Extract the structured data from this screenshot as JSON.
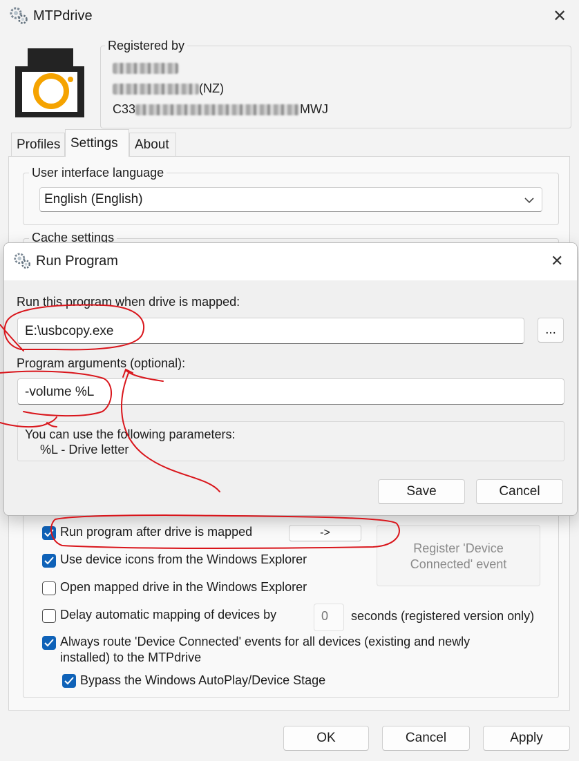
{
  "window": {
    "title": "MTPdrive",
    "icon": "gear-icon"
  },
  "registration": {
    "label": "Registered by",
    "line1_visible": "",
    "line2_visible": "(NZ)",
    "line3_prefix": "C33",
    "line3_suffix": "MWJ"
  },
  "tabs": [
    {
      "label": "Profiles",
      "active": false
    },
    {
      "label": "Settings",
      "active": true
    },
    {
      "label": "About",
      "active": false
    }
  ],
  "settings": {
    "ui_language_label": "User interface language",
    "ui_language_value": "English (English)",
    "cache_label": "Cache settings",
    "options": [
      {
        "label": "Run program after drive is mapped",
        "checked": true
      },
      {
        "label": "Use device icons from the Windows Explorer",
        "checked": true
      },
      {
        "label": "Open mapped drive in the Windows Explorer",
        "checked": false
      },
      {
        "label": "Delay automatic mapping of devices by",
        "checked": false
      },
      {
        "label": "Always route 'Device Connected' events for all devices (existing and newly",
        "label2": "installed) to the MTPdrive",
        "checked": true
      },
      {
        "label": "Bypass the Windows AutoPlay/Device Stage",
        "checked": true
      }
    ],
    "run_program_arrow_button": "->",
    "register_button": "Register 'Device Connected' event",
    "register_button_line1": "Register 'Device",
    "register_button_line2": "Connected' event",
    "delay_value": "0",
    "delay_suffix": "seconds (registered version only)"
  },
  "footer": {
    "ok": "OK",
    "cancel": "Cancel",
    "apply": "Apply"
  },
  "dialog": {
    "title": "Run Program",
    "program_label": "Run this program when drive is mapped:",
    "program_value": "E:\\usbcopy.exe",
    "browse_label": "...",
    "args_label": "Program arguments (optional):",
    "args_value": "-volume %L",
    "params_intro": "You can use the following parameters:",
    "params_item": "%L - Drive letter",
    "save": "Save",
    "cancel": "Cancel"
  },
  "colors": {
    "accent": "#0f62b8",
    "logo_orange": "#f5a300",
    "annotation_red": "#d9151b"
  }
}
